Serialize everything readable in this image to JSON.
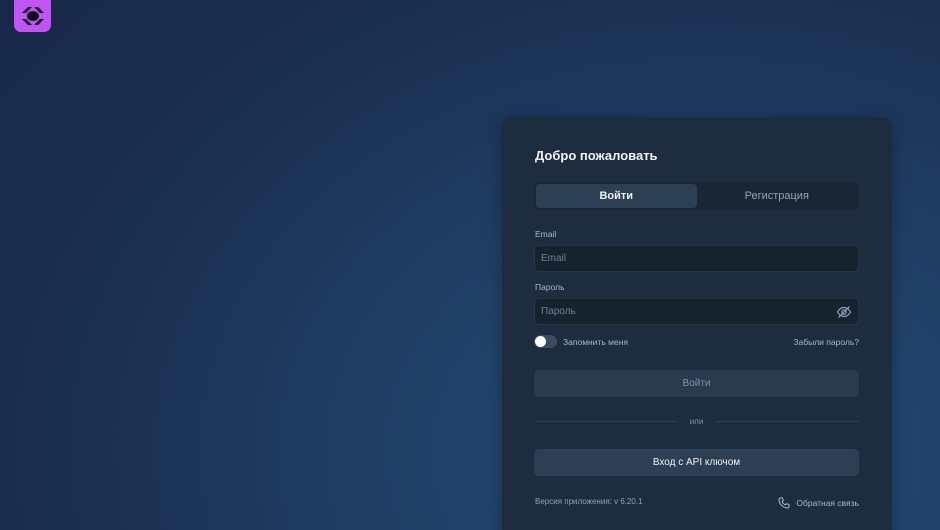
{
  "app": {
    "logo_icon": "app-logo-icon",
    "accent": "#c254f5"
  },
  "card": {
    "title": "Добро пожаловать",
    "tabs": [
      {
        "label": "Войти",
        "active": true
      },
      {
        "label": "Регистрация",
        "active": false
      }
    ],
    "email": {
      "label": "Email",
      "placeholder": "Email",
      "value": ""
    },
    "password": {
      "label": "Пароль",
      "placeholder": "Пароль",
      "value": "",
      "icon": "eye-off-icon"
    },
    "remember": {
      "label": "Запомнить меня",
      "checked": false
    },
    "forgot_label": "Забыли пароль?",
    "login_button": "Войти",
    "divider_text": "или",
    "api_button": "Вход с API ключом",
    "version": "Версия приложения: v 6.20.1",
    "feedback": {
      "label": "Обратная связь",
      "icon": "phone-icon"
    }
  }
}
